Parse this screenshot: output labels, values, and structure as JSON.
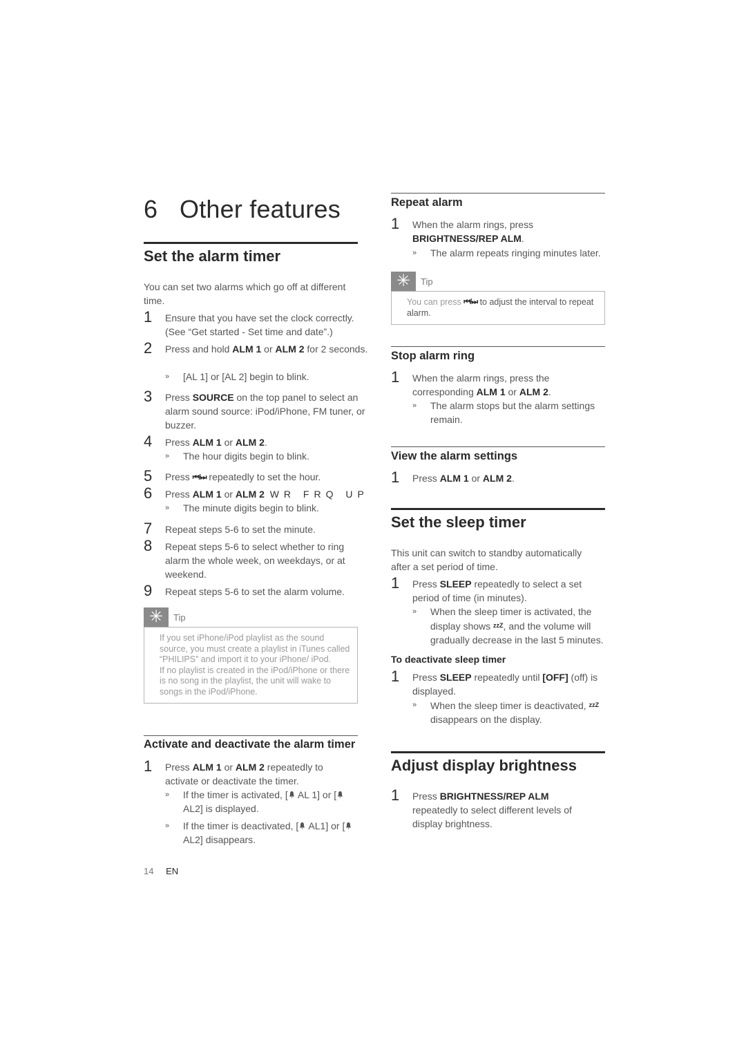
{
  "chapter": {
    "number": "6",
    "title": "Other features"
  },
  "left": {
    "set_alarm": {
      "heading": "Set the alarm timer",
      "intro": "You can set two alarms which go off at different time.",
      "steps": [
        {
          "n": "1",
          "text": "Ensure that you have set the clock correctly. (See “Get started - Set time and date”.)"
        },
        {
          "n": "2",
          "pre": "Press and hold ",
          "k1": "ALM 1",
          "mid": " or ",
          "k2": "ALM 2",
          "post": " for 2 seconds.",
          "bullet": "[AL 1] or [AL 2] begin to blink."
        },
        {
          "n": "3",
          "pre": "Press ",
          "k1": "SOURCE",
          "post": " on the top panel to select an alarm sound source: iPod/iPhone, FM tuner, or buzzer."
        },
        {
          "n": "4",
          "pre": "Press ",
          "k1": "ALM 1",
          "mid": " or ",
          "k2": "ALM 2",
          "post": ".",
          "bullet": "The hour digits begin to blink."
        },
        {
          "n": "5",
          "pre": "Press ",
          "post": " repeatedly to set the hour."
        },
        {
          "n": "6",
          "pre": "Press ",
          "k1": "ALM 1",
          "mid": " or ",
          "k2": "ALM 2",
          "garble": "WR FRQ UP",
          "bullet": "The minute digits begin to blink."
        },
        {
          "n": "7",
          "text": "Repeat steps 5-6 to set the minute."
        },
        {
          "n": "8",
          "text": "Repeat steps 5-6 to select whether to ring alarm the whole week, on weekdays, or at weekend."
        },
        {
          "n": "9",
          "text": "Repeat steps 5-6 to set the alarm volume."
        }
      ],
      "tip": {
        "label": "Tip",
        "p1": "If you set iPhone/iPod playlist as the sound source, you must create a playlist in iTunes called “PHILIPS” and import it to your iPhone/ iPod.",
        "p2": "If no playlist is created in the iPod/iPhone or there is no song in the playlist, the unit will wake to songs in the iPod/iPhone."
      }
    },
    "activate": {
      "heading": "Activate and deactivate the alarm timer",
      "step": {
        "n": "1",
        "pre": "Press ",
        "k1": "ALM 1",
        "mid": " or ",
        "k2": "ALM 2",
        "post": " repeatedly to activate or deactivate the timer."
      },
      "bullets": [
        {
          "a": "If the timer is activated, [",
          "b": " AL 1] or [",
          "c": " AL2] is displayed."
        },
        {
          "a": "If the timer is deactivated, [",
          "b": " AL1] or [",
          "c": " AL2] disappears."
        }
      ]
    }
  },
  "right": {
    "repeat": {
      "heading": "Repeat alarm",
      "step": {
        "n": "1",
        "pre": "When the alarm rings, press ",
        "k1": "BRIGHTNESS/REP ALM",
        "post": "."
      },
      "bullet": "The alarm repeats ringing minutes later.",
      "tip": {
        "label": "Tip",
        "pre": "You can press ",
        "post": " to adjust the interval to repeat alarm."
      }
    },
    "stop": {
      "heading": "Stop alarm ring",
      "step": {
        "n": "1",
        "pre": "When the alarm rings, press the corresponding ",
        "k1": "ALM 1",
        "mid": " or ",
        "k2": "ALM 2",
        "post": "."
      },
      "bullet": "The alarm stops but the alarm settings remain."
    },
    "view": {
      "heading": "View the alarm settings",
      "step": {
        "n": "1",
        "pre": "Press ",
        "k1": "ALM 1",
        "mid": " or ",
        "k2": "ALM 2",
        "post": "."
      }
    },
    "sleep": {
      "heading": "Set the sleep timer",
      "intro": "This unit can switch to standby automatically after a set period of time.",
      "step": {
        "n": "1",
        "pre": "Press ",
        "k1": "SLEEP",
        "post": " repeatedly to select a set period of time (in minutes)."
      },
      "bullet": {
        "a": "When the sleep timer is activated, the display shows ",
        "b": ", and the volume will gradually decrease in the last 5 minutes."
      },
      "deactivate_heading": "To deactivate sleep timer",
      "deactivate_step": {
        "n": "1",
        "pre": "Press ",
        "k1": "SLEEP",
        "mid": " repeatedly until ",
        "k2": "[OFF]",
        "post": " (off) is displayed."
      },
      "deactivate_bullet": {
        "a": "When the sleep timer is deactivated, ",
        "b": " disappears on the display."
      }
    },
    "brightness": {
      "heading": "Adjust display brightness",
      "step": {
        "n": "1",
        "pre": "Press ",
        "k1": "BRIGHTNESS/REP ALM",
        "post": " repeatedly to select different levels of display brightness."
      }
    }
  },
  "icons": {
    "media": "⏮/⏭",
    "zzz": "zzZ",
    "tip": "✳",
    "bullet": "»"
  },
  "footer": {
    "page": "14",
    "lang": "EN"
  }
}
